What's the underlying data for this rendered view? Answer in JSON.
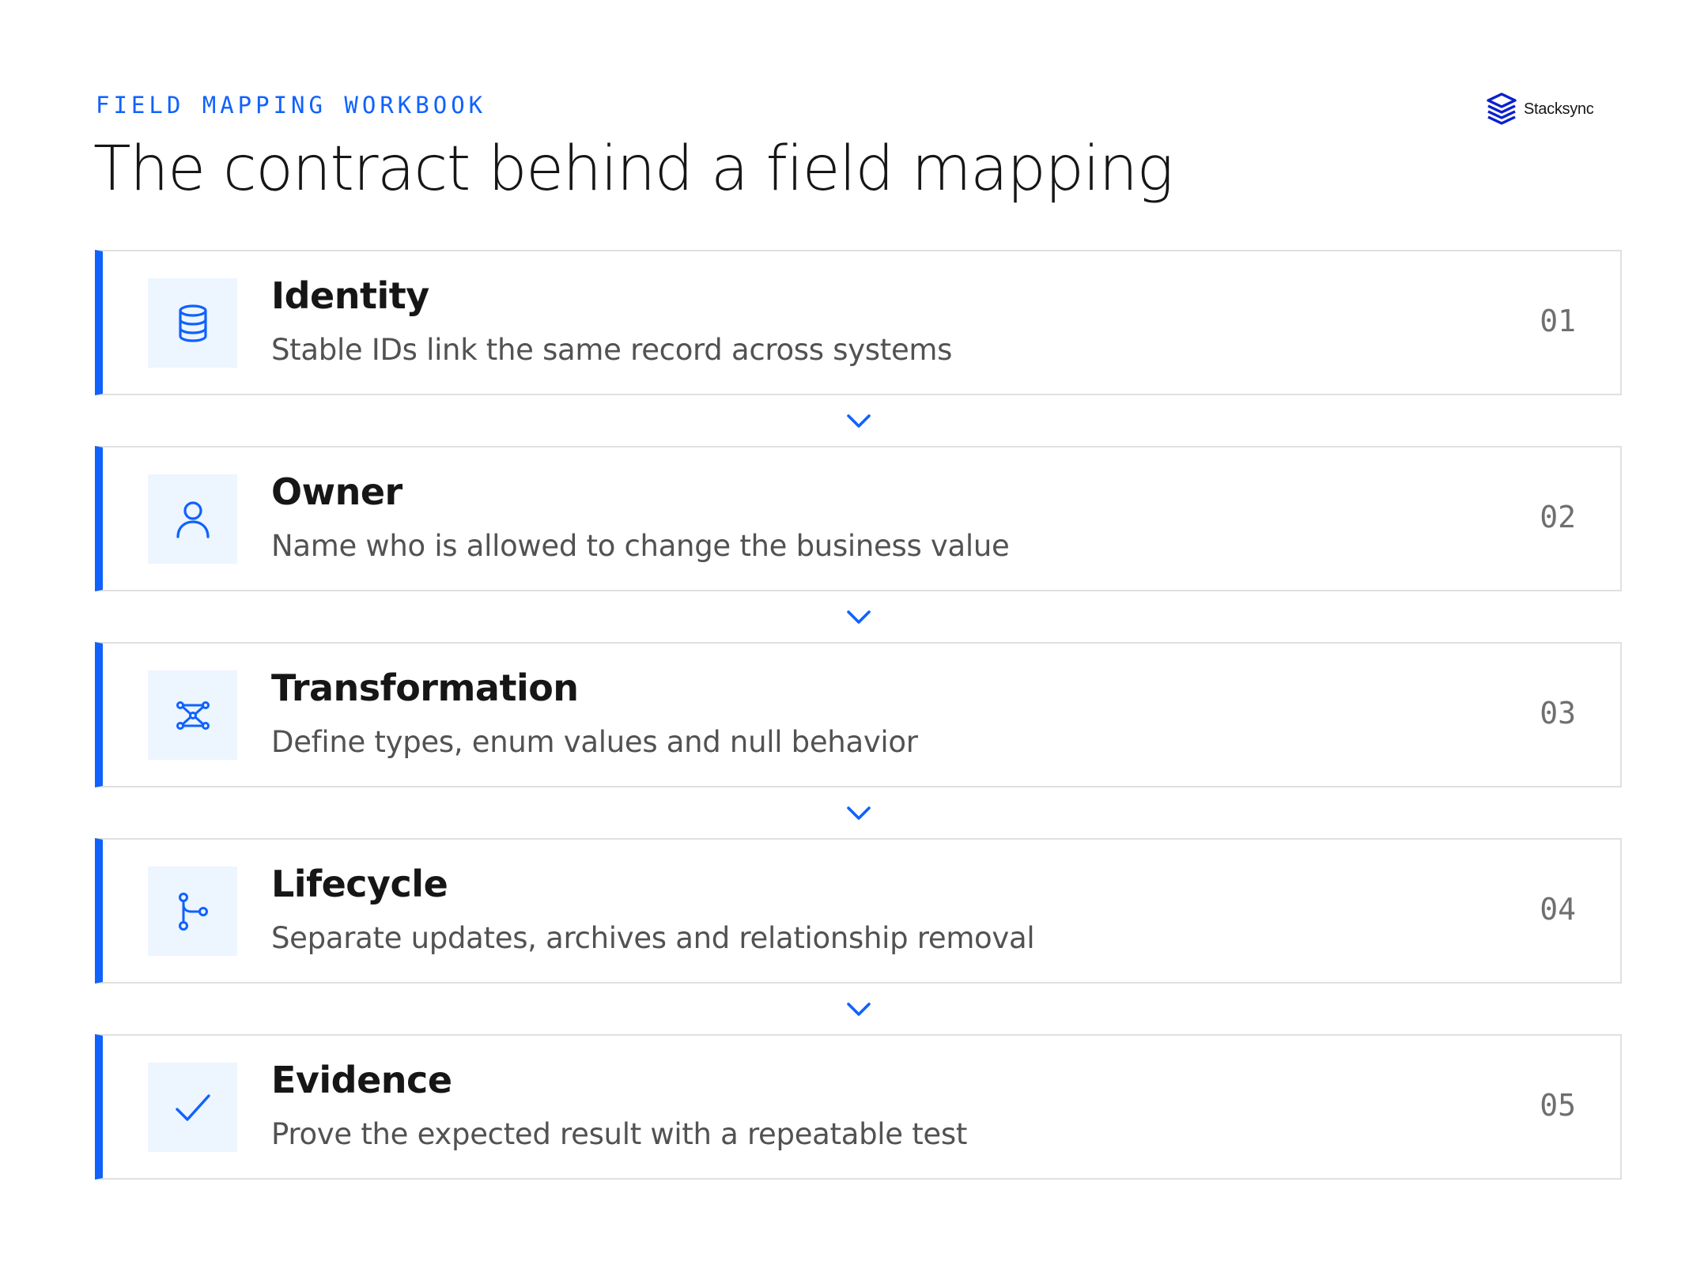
{
  "header": {
    "eyebrow": "FIELD MAPPING WORKBOOK",
    "title": "The contract behind a field mapping"
  },
  "brand": {
    "name": "Stacksync",
    "logo_icon": "stacked-layers-logo-icon"
  },
  "colors": {
    "accent": "#0f62fe",
    "icon_bg": "#edf5ff",
    "border": "#e0e0e0",
    "title_text": "#161616",
    "body_text": "#525252",
    "number_text": "#6f6f6f"
  },
  "steps": [
    {
      "number": "01",
      "title": "Identity",
      "description": "Stable IDs link the same record across systems",
      "icon": "database-icon"
    },
    {
      "number": "02",
      "title": "Owner",
      "description": "Name who is allowed to change the business value",
      "icon": "user-icon"
    },
    {
      "number": "03",
      "title": "Transformation",
      "description": "Define types, enum values and null behavior",
      "icon": "data-mapping-icon"
    },
    {
      "number": "04",
      "title": "Lifecycle",
      "description": "Separate updates, archives and relationship removal",
      "icon": "branch-icon"
    },
    {
      "number": "05",
      "title": "Evidence",
      "description": "Prove the expected result with a repeatable test",
      "icon": "checkmark-icon"
    }
  ],
  "connector_icon": "chevron-down-icon"
}
